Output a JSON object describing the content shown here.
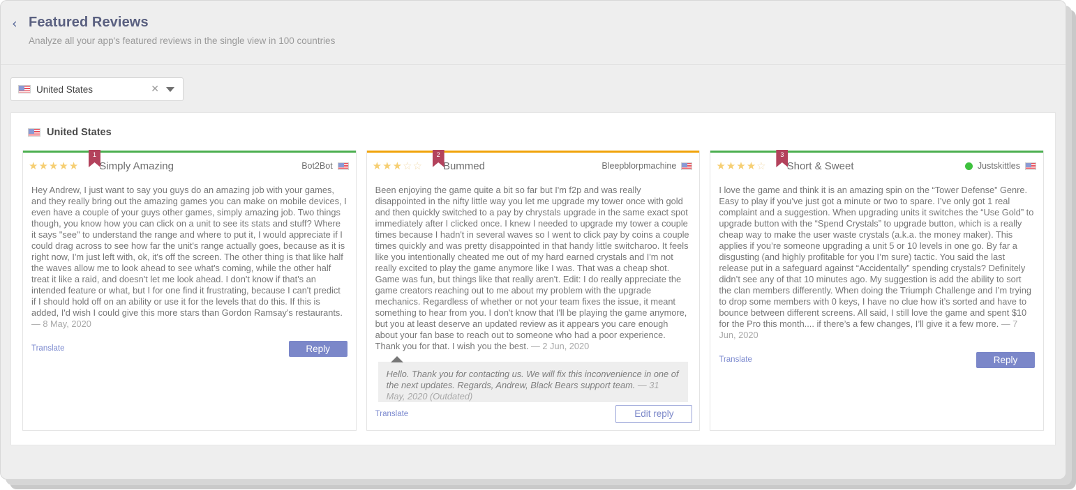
{
  "header": {
    "back_icon": "chevron-left-icon",
    "title": "Featured Reviews",
    "subtitle": "Analyze all your app's featured reviews in the single view in 100 countries"
  },
  "filter": {
    "country_value": "United States",
    "clear_icon": "close-icon",
    "caret_icon": "chevron-down-icon",
    "flag_icon": "us-flag-icon"
  },
  "section": {
    "country_heading": "United States",
    "flag_icon": "us-flag-icon"
  },
  "colors": {
    "accent_green": "#4caf50",
    "accent_orange": "#f0a30a",
    "ribbon": "#b3425c",
    "button_primary": "#7b87c9",
    "star_filled": "#f6cf73",
    "star_empty": "#f3ddb0",
    "status_online": "#3ec13e"
  },
  "cards": [
    {
      "rank": "1",
      "rating": 5,
      "max_rating": 5,
      "top_border_color": "#4caf50",
      "title": "Simply Amazing",
      "author": "Bot2Bot",
      "has_status_dot": false,
      "flag_icon": "us-flag-icon",
      "body": "Hey Andrew, I just want to say you guys do an amazing job with your games, and they really bring out the amazing games you can make on mobile devices, I even have a couple of your guys other games, simply amazing job. Two things though, you know how you can click on a unit to see its stats and stuff? Where it says \"see\" to understand the range and where to put it, I would appreciate if I could drag across to see how far the unit's range actually goes, because as it is right now, I'm just left with, ok, it's off the screen. The other thing is that like half the waves allow me to look ahead to see what's coming, while the other half treat it like a raid, and doesn't let me look ahead. I don't know if that's an intended feature or what, but I for one find it frustrating, because I can't predict if I should hold off on an ability or use it for the levels that do this. If this is added, I'd wish I could give this more stars than Gordon Ramsay's restaurants.",
      "date": "— 8 May, 2020",
      "reply": null,
      "translate_label": "Translate",
      "action_label": "Reply",
      "action_type": "primary"
    },
    {
      "rank": "2",
      "rating": 3,
      "max_rating": 5,
      "top_border_color": "#f0a30a",
      "title": "Bummed",
      "author": "Bleepblorpmachine",
      "has_status_dot": false,
      "flag_icon": "us-flag-icon",
      "body": "Been enjoying the game quite a bit so far but I'm f2p and was really disappointed in the nifty little way you let me upgrade my tower once with gold and then quickly switched to a pay by chrystals upgrade in the same exact spot immediately after I clicked once. I knew I needed to upgrade my tower a couple times because I hadn't in several waves so I went to click pay by coins a couple times quickly and was pretty disappointed in that handy little switcharoo. It feels like you intentionally cheated me out of my hard earned crystals and I'm not really excited to play the game anymore like I was. That was a cheap shot. Game was fun, but things like that really aren't. Edit: I do really appreciate the game creators reaching out to me about my problem with the upgrade mechanics. Regardless of whether or not your team fixes the issue, it meant something to hear from you. I don't know that I'll be playing the game anymore, but you at least deserve an updated review as it appears you care enough about your fan base to reach out to someone who had a poor experience. Thank you for that. I wish you the best.",
      "date": "— 2 Jun, 2020",
      "reply": {
        "text": "Hello. Thank you for contacting us. We will fix this inconvenience in one of the next updates. Regards, Andrew, Black Bears support team.",
        "date": "— 31 May, 2020 (Outdated)"
      },
      "translate_label": "Translate",
      "action_label": "Edit reply",
      "action_type": "outline"
    },
    {
      "rank": "3",
      "rating": 4,
      "max_rating": 5,
      "top_border_color": "#4caf50",
      "title": "Short & Sweet",
      "author": "Justskittles",
      "has_status_dot": true,
      "flag_icon": "us-flag-icon",
      "body": "I love the game and think it is an amazing spin on the “Tower Defense” Genre. Easy to play if you’ve just got a minute or two to spare. I’ve only got 1 real complaint and a suggestion. When upgrading units it switches the “Use Gold” to upgrade button with the “Spend Crystals” to upgrade button, which is a really cheap way to make the user waste crystals (a.k.a. the money maker). This applies if you’re someone upgrading a unit 5 or 10 levels in one go. By far a disgusting (and highly profitable for you I’m sure) tactic. You said the last release put in a safeguard against “Accidentally” spending crystals? Definitely didn’t see any of that 10 minutes ago. My suggestion is add the ability to sort the clan members differently. When doing the Triumph Challenge and I’m trying to drop some members with 0 keys, I have no clue how it’s sorted and have to bounce between different screens. All said, I still love the game and spent $10 for the Pro this month.... if there’s a few changes, I’ll give it a few more.",
      "date": "— 7 Jun, 2020",
      "reply": null,
      "translate_label": "Translate",
      "action_label": "Reply",
      "action_type": "primary"
    }
  ]
}
